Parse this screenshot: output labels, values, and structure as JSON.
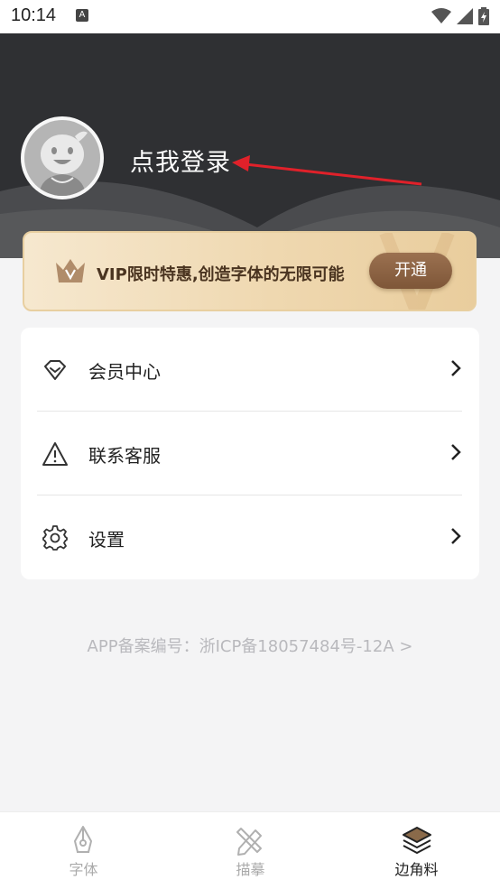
{
  "status_bar": {
    "time": "10:14",
    "app_icon": "A"
  },
  "header": {
    "login_label": "点我登录"
  },
  "vip_banner": {
    "text": "VIP限时特惠,创造字体的无限可能",
    "button_label": "开通"
  },
  "menu": {
    "items": [
      {
        "label": "会员中心",
        "icon": "diamond-icon"
      },
      {
        "label": "联系客服",
        "icon": "warning-triangle-icon"
      },
      {
        "label": "设置",
        "icon": "gear-icon"
      }
    ]
  },
  "footer": {
    "icp": "APP备案编号：浙ICP备18057484号-12A >"
  },
  "bottom_nav": {
    "items": [
      {
        "label": "字体",
        "icon": "pen-nib-icon",
        "active": false
      },
      {
        "label": "描摹",
        "icon": "pencil-ruler-icon",
        "active": false
      },
      {
        "label": "边角料",
        "icon": "layers-icon",
        "active": true
      }
    ]
  },
  "colors": {
    "header_bg": "#2f3033",
    "vip_button": "#8a6244",
    "annotation_arrow": "#e0212a",
    "page_bg": "#f4f4f5"
  }
}
